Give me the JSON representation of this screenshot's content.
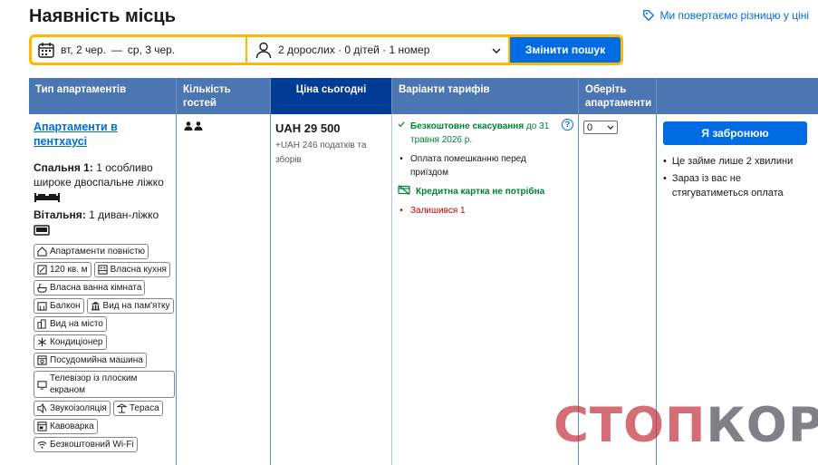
{
  "page": {
    "title": "Наявність місць",
    "price_match": "Ми повертаємо різницю у ціні"
  },
  "search": {
    "check_in": "вт, 2 чер.",
    "separator": "—",
    "check_out": "ср, 3 чер.",
    "guests": "2 дорослих · 0 дітей · 1 номер",
    "button": "Змінити пошук"
  },
  "table": {
    "headers": {
      "room_type": "Тип апартаментів",
      "guests": "Кількість гостей",
      "price": "Ціна сьогодні",
      "options": "Варіанти тарифів",
      "select": "Оберіть апартаменти"
    },
    "room": {
      "name": "Апартаменти в пентхаусі",
      "bed1_label": "Спальня 1:",
      "bed1_value": "1 особливо широке двоспальне ліжко",
      "bed2_label": "Вітальня:",
      "bed2_value": "1 диван-ліжко",
      "facilities": [
        {
          "label": "Апартаменти повністю",
          "icon": "home-icon"
        },
        {
          "label": "120 кв. м",
          "icon": "area-icon"
        },
        {
          "label": "Власна кухня",
          "icon": "kitchen-icon"
        },
        {
          "label": "Власна ванна кімната",
          "icon": "bath-icon"
        },
        {
          "label": "Балкон",
          "icon": "balcony-icon"
        },
        {
          "label": "Вид на пам'ятку",
          "icon": "landmark-icon"
        },
        {
          "label": "Вид на місто",
          "icon": "city-icon"
        },
        {
          "label": "Кондиціонер",
          "icon": "snowflake-icon"
        },
        {
          "label": "Посудомийна машина",
          "icon": "dishwasher-icon"
        },
        {
          "label": "Телевізор із плоским екраном",
          "icon": "tv-icon"
        },
        {
          "label": "Звукоізоляція",
          "icon": "soundproof-icon"
        },
        {
          "label": "Тераса",
          "icon": "terrace-icon"
        },
        {
          "label": "Кавоварка",
          "icon": "coffee-icon"
        },
        {
          "label": "Безкоштовний Wi-Fi",
          "icon": "wifi-icon"
        }
      ]
    },
    "price": {
      "amount": "UAH 29 500",
      "taxes": "+UAH 246 податків та зборів"
    },
    "options": {
      "free_cancel": "Безкоштовне скасування",
      "free_cancel_date": "до 31 травня 2026 р.",
      "pay_before": "Оплата помешканню перед приїздом",
      "no_card": "Кредитна картка не потрібна",
      "left": "Залишився 1",
      "help": "?"
    },
    "select_value": "0",
    "reserve": {
      "button": "Я забронюю",
      "bullets": [
        "Це займе лише 2 хвилини",
        "Зараз із вас не стягуватиметься оплата"
      ]
    }
  },
  "watermark": {
    "part1": "СТОП",
    "part2": "КОР"
  },
  "colors": {
    "header_blue": "#4c76b2",
    "active_header": "#003b95",
    "primary": "#006ce4",
    "accent_yellow": "#ffb700",
    "green": "#008234"
  }
}
